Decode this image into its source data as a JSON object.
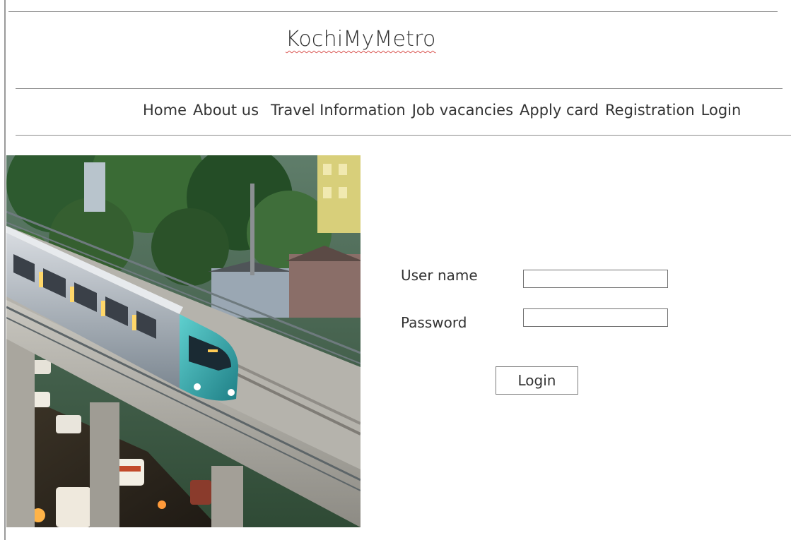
{
  "header": {
    "site_title": "KochiMyMetro"
  },
  "nav": {
    "items": [
      {
        "label": "Home"
      },
      {
        "label": "About us"
      },
      {
        "label": "Travel Information"
      },
      {
        "label": "Job vacancies"
      },
      {
        "label": "Apply card"
      },
      {
        "label": "Registration"
      },
      {
        "label": "Login"
      }
    ]
  },
  "hero": {
    "image_alt": "metro-train-photo"
  },
  "login_form": {
    "username_label": "User name",
    "username_value": "",
    "password_label": "Password",
    "password_value": "",
    "submit_label": "Login"
  },
  "colors": {
    "text": "#333333",
    "rule": "#8a8a8a",
    "train_teal": "#3fb3b5"
  }
}
